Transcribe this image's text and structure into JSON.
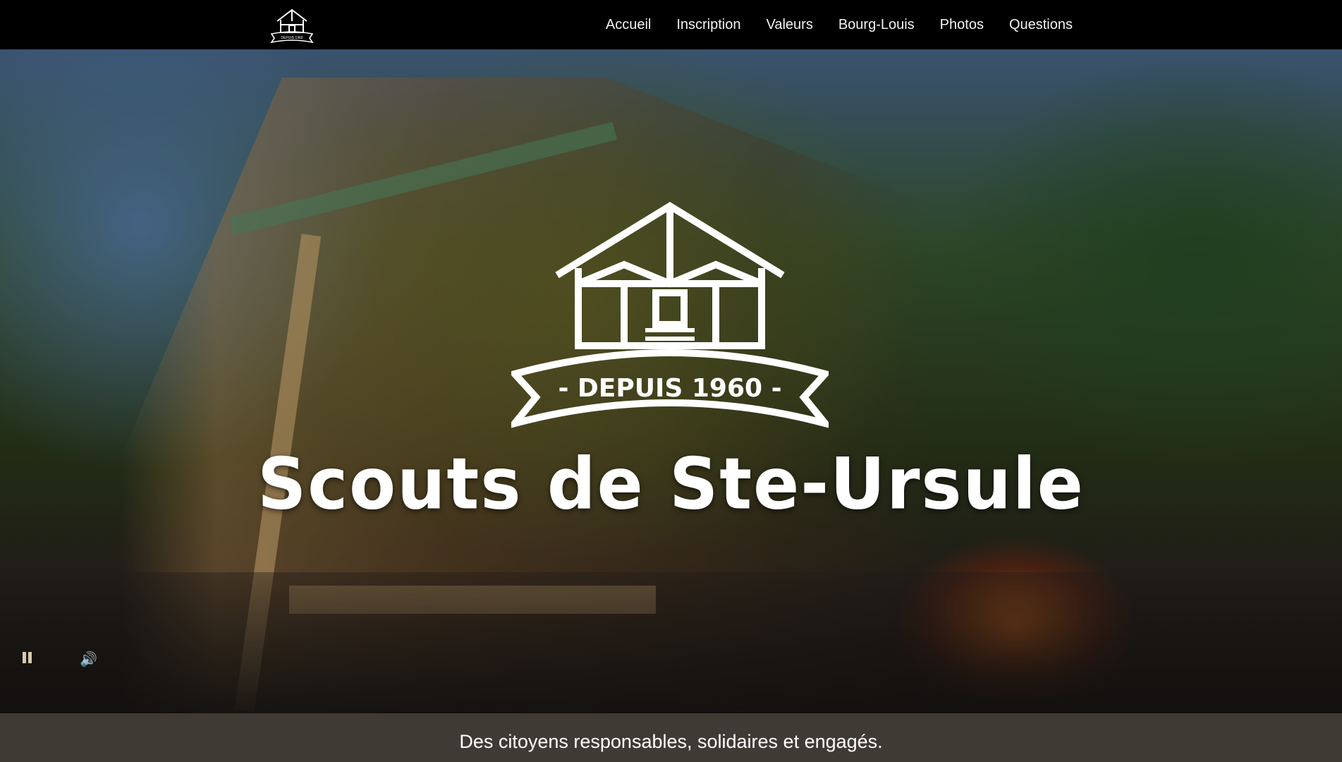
{
  "header": {
    "logo_badge_text": "DEPUIS 1960",
    "nav": [
      {
        "label": "Accueil"
      },
      {
        "label": "Inscription"
      },
      {
        "label": "Valeurs"
      },
      {
        "label": "Bourg-Louis"
      },
      {
        "label": "Photos"
      },
      {
        "label": "Questions"
      }
    ]
  },
  "hero": {
    "badge_text": "- DEPUIS 1960 -",
    "title": "Scouts de Ste-Ursule",
    "controls": {
      "pause_icon": "pause-icon",
      "volume_icon": "volume-icon"
    }
  },
  "footer": {
    "tagline": "Des citoyens responsables, solidaires et engagés."
  },
  "colors": {
    "topbar": "#000000",
    "tagline_band": "#403a34",
    "text": "#ffffff",
    "control_tint": "#d8cba8"
  }
}
